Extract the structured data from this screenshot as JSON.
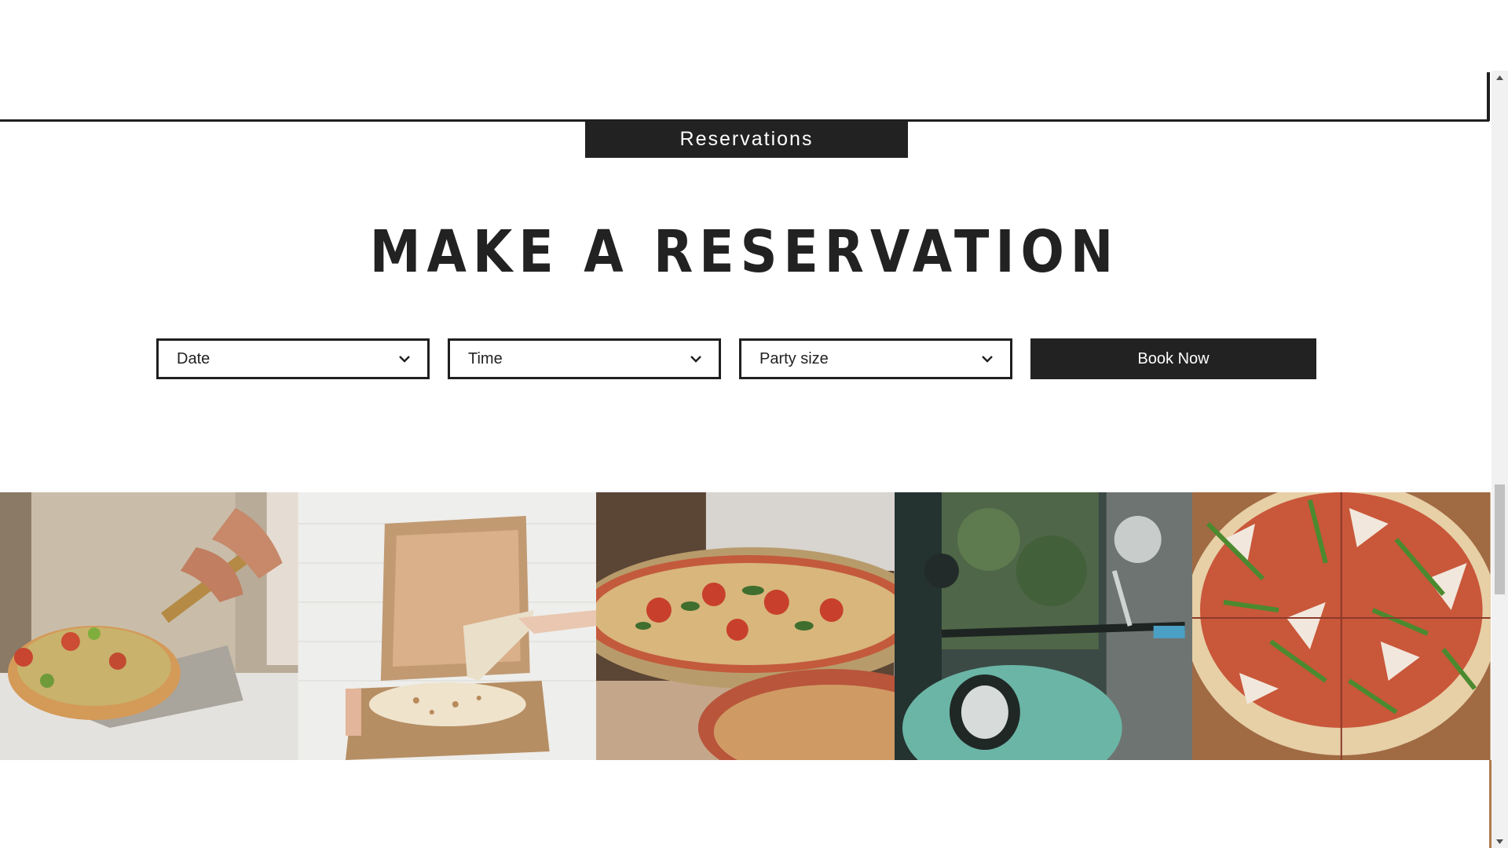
{
  "section_tab": {
    "label": "Reservations"
  },
  "heading": "MAKE A RESERVATION",
  "form": {
    "date": {
      "label": "Date"
    },
    "time": {
      "label": "Time"
    },
    "party": {
      "label": "Party size"
    },
    "book_label": "Book Now"
  },
  "gallery": [
    {
      "icon": "pizza-peel-photo"
    },
    {
      "icon": "pizza-box-photo"
    },
    {
      "icon": "margherita-pizza-photo"
    },
    {
      "icon": "scooter-photo"
    },
    {
      "icon": "arugula-pizza-photo"
    }
  ],
  "colors": {
    "dark": "#222222",
    "background": "#ffffff"
  }
}
